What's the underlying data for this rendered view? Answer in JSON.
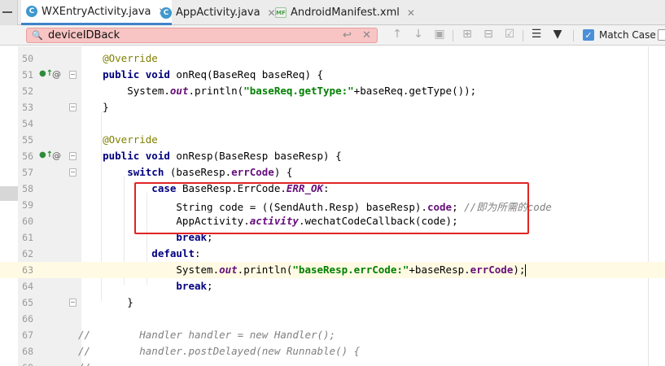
{
  "tabs": [
    {
      "label": "WXEntryActivity.java",
      "icon": "C",
      "active": true
    },
    {
      "label": "AppActivity.java",
      "icon": "C",
      "active": false
    },
    {
      "label": "AndroidManifest.xml",
      "icon": "MF",
      "active": false
    }
  ],
  "search": {
    "query": "deviceIDBack",
    "match_case_label": "Match Case",
    "match_case_checked": true
  },
  "toolbar_icons": [
    "arrow-up-icon",
    "arrow-down-icon",
    "find-in-file-icon",
    "add-occurrence-icon",
    "remove-occurrence-icon",
    "select-all-occurrences-icon",
    "multiline-icon",
    "filter-icon"
  ],
  "editor": {
    "current_line": "63",
    "lines": [
      {
        "no": "50",
        "t": [
          [
            "ann",
            "    @Override"
          ]
        ]
      },
      {
        "no": "51",
        "t": [
          [
            "kw",
            "    public void "
          ],
          [
            "",
            "onReq(BaseReq baseReq) {"
          ]
        ]
      },
      {
        "no": "52",
        "t": [
          [
            "",
            "        System."
          ],
          [
            "sfld",
            "out"
          ],
          [
            "",
            ".println("
          ],
          [
            "str",
            "\"baseReq.getType:\""
          ],
          [
            "",
            "+baseReq.getType());"
          ]
        ]
      },
      {
        "no": "53",
        "t": [
          [
            "",
            "    }"
          ]
        ]
      },
      {
        "no": "54",
        "t": [
          [
            "",
            ""
          ]
        ]
      },
      {
        "no": "55",
        "t": [
          [
            "ann",
            "    @Override"
          ]
        ]
      },
      {
        "no": "56",
        "t": [
          [
            "kw",
            "    public void "
          ],
          [
            "",
            "onResp(BaseResp baseResp) {"
          ]
        ]
      },
      {
        "no": "57",
        "t": [
          [
            "kw",
            "        switch "
          ],
          [
            "",
            "(baseResp."
          ],
          [
            "fld",
            "errCode"
          ],
          [
            "",
            ") {"
          ]
        ]
      },
      {
        "no": "58",
        "t": [
          [
            "kw",
            "            case "
          ],
          [
            "",
            "BaseResp.ErrCode."
          ],
          [
            "sfld",
            "ERR_OK"
          ],
          [
            "",
            ":"
          ]
        ]
      },
      {
        "no": "59",
        "t": [
          [
            "",
            "                String code = ((SendAuth.Resp) baseResp)."
          ],
          [
            "fld",
            "code"
          ],
          [
            "",
            "; "
          ],
          [
            "cmt",
            "//即为所需的code"
          ]
        ]
      },
      {
        "no": "60",
        "t": [
          [
            "",
            "                AppActivity."
          ],
          [
            "sfld",
            "activity"
          ],
          [
            "",
            ".wechatCodeCallback(code);"
          ]
        ]
      },
      {
        "no": "61",
        "t": [
          [
            "kw",
            "                break"
          ],
          [
            "",
            ";"
          ]
        ]
      },
      {
        "no": "62",
        "t": [
          [
            "kw",
            "            default"
          ],
          [
            "",
            ":"
          ]
        ]
      },
      {
        "no": "63",
        "t": [
          [
            "",
            "                System."
          ],
          [
            "sfld",
            "out"
          ],
          [
            "",
            ".println("
          ],
          [
            "str",
            "\"baseResp.errCode:\""
          ],
          [
            "",
            "+baseResp."
          ],
          [
            "fld",
            "errCode"
          ],
          [
            "",
            ");"
          ]
        ]
      },
      {
        "no": "64",
        "t": [
          [
            "kw",
            "                break"
          ],
          [
            "",
            ";"
          ]
        ]
      },
      {
        "no": "65",
        "t": [
          [
            "",
            "        }"
          ]
        ]
      },
      {
        "no": "66",
        "t": [
          [
            "",
            ""
          ]
        ]
      },
      {
        "no": "67",
        "t": [
          [
            "cmt",
            "//        Handler handler = new Handler();"
          ]
        ]
      },
      {
        "no": "68",
        "t": [
          [
            "cmt",
            "//        handler.postDelayed(new Runnable() {"
          ]
        ]
      },
      {
        "no": "69",
        "t": [
          [
            "cmt",
            "//"
          ]
        ]
      }
    ]
  },
  "colors": {
    "keyword": "#000080",
    "annotation": "#808000",
    "string": "#008000",
    "field": "#660e7a",
    "comment": "#808080",
    "search_bg": "#f8c4c4",
    "highlight_box": "#e02424",
    "current_line_bg": "#fffae3"
  }
}
